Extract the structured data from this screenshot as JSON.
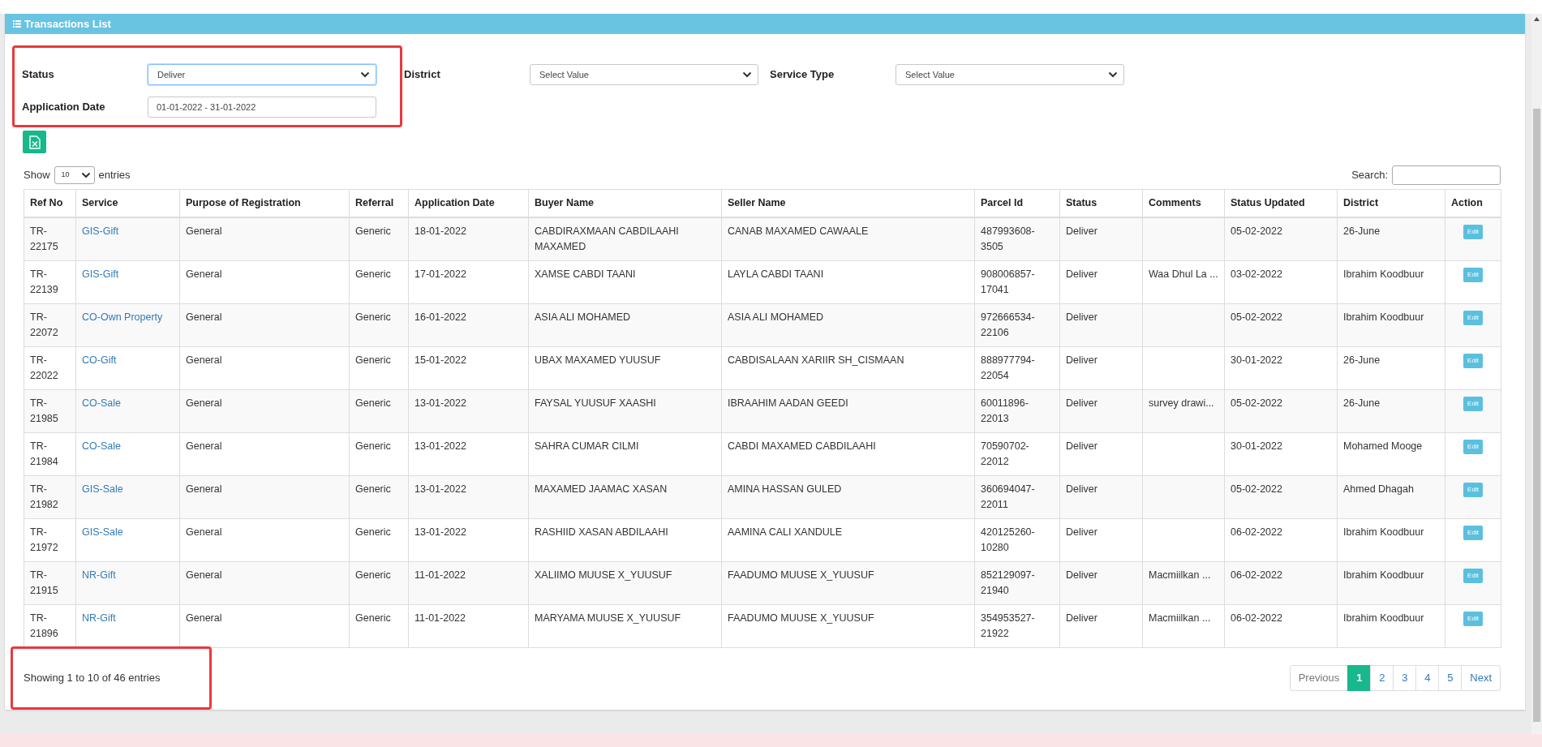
{
  "panel": {
    "title": "Transactions List"
  },
  "filter_groups": [
    {
      "highlighted": true,
      "fields": [
        {
          "label": "Status",
          "kind": "select",
          "value": "Deliver",
          "focused": true
        },
        {
          "label": "Application Date",
          "kind": "text",
          "value": "01-01-2022 - 31-01-2022",
          "focused": false
        }
      ]
    },
    {
      "highlighted": false,
      "fields": [
        {
          "label": "District",
          "kind": "select",
          "value": "Select Value",
          "focused": false
        }
      ]
    },
    {
      "highlighted": false,
      "fields": [
        {
          "label": "Service Type",
          "kind": "select",
          "value": "Select Value",
          "focused": false
        }
      ]
    }
  ],
  "length_control": {
    "before": "Show",
    "value": "10",
    "after": "entries"
  },
  "search": {
    "label": "Search:"
  },
  "table": {
    "columns": [
      {
        "label": "Ref No",
        "kind": "text"
      },
      {
        "label": "Service",
        "kind": "link"
      },
      {
        "label": "Purpose of Registration",
        "kind": "text"
      },
      {
        "label": "Referral",
        "kind": "text"
      },
      {
        "label": "Application Date",
        "kind": "text"
      },
      {
        "label": "Buyer Name",
        "kind": "text"
      },
      {
        "label": "Seller Name",
        "kind": "text"
      },
      {
        "label": "Parcel Id",
        "kind": "text"
      },
      {
        "label": "Status",
        "kind": "text"
      },
      {
        "label": "Comments",
        "kind": "text"
      },
      {
        "label": "Status Updated",
        "kind": "text"
      },
      {
        "label": "District",
        "kind": "text"
      },
      {
        "label": "Action",
        "kind": "button"
      }
    ],
    "rows": [
      [
        "TR-22175",
        "GIS-Gift",
        "General",
        "Generic",
        "18-01-2022",
        "CABDIRAXMAAN CABDILAAHI MAXAMED",
        "CANAB MAXAMED CAWAALE",
        "487993608-3505",
        "Deliver",
        "",
        "05-02-2022",
        "26-June",
        "Edit"
      ],
      [
        "TR-22139",
        "GIS-Gift",
        "General",
        "Generic",
        "17-01-2022",
        "XAMSE CABDI TAANI",
        "LAYLA CABDI TAANI",
        "908006857-17041",
        "Deliver",
        "Waa Dhul La ...",
        "03-02-2022",
        "Ibrahim Koodbuur",
        "Edit"
      ],
      [
        "TR-22072",
        "CO-Own Property",
        "General",
        "Generic",
        "16-01-2022",
        "ASIA ALI MOHAMED",
        "ASIA ALI MOHAMED",
        "972666534-22106",
        "Deliver",
        "",
        "05-02-2022",
        "Ibrahim Koodbuur",
        "Edit"
      ],
      [
        "TR-22022",
        "CO-Gift",
        "General",
        "Generic",
        "15-01-2022",
        "UBAX MAXAMED YUUSUF",
        "CABDISALAAN XARIIR SH_CISMAAN",
        "888977794-22054",
        "Deliver",
        "",
        "30-01-2022",
        "26-June",
        "Edit"
      ],
      [
        "TR-21985",
        "CO-Sale",
        "General",
        "Generic",
        "13-01-2022",
        "FAYSAL YUUSUF XAASHI",
        "IBRAAHIM AADAN GEEDI",
        "60011896-22013",
        "Deliver",
        "survey drawi...",
        "05-02-2022",
        "26-June",
        "Edit"
      ],
      [
        "TR-21984",
        "CO-Sale",
        "General",
        "Generic",
        "13-01-2022",
        "SAHRA CUMAR CILMI",
        "CABDI MAXAMED CABDILAAHI",
        "70590702-22012",
        "Deliver",
        "",
        "30-01-2022",
        "Mohamed Mooge",
        "Edit"
      ],
      [
        "TR-21982",
        "GIS-Sale",
        "General",
        "Generic",
        "13-01-2022",
        "MAXAMED JAAMAC XASAN",
        "AMINA HASSAN GULED",
        "360694047-22011",
        "Deliver",
        "",
        "05-02-2022",
        "Ahmed Dhagah",
        "Edit"
      ],
      [
        "TR-21972",
        "GIS-Sale",
        "General",
        "Generic",
        "13-01-2022",
        "RASHIID XASAN ABDILAAHI",
        "AAMINA CALI XANDULE",
        "420125260-10280",
        "Deliver",
        "",
        "06-02-2022",
        "Ibrahim Koodbuur",
        "Edit"
      ],
      [
        "TR-21915",
        "NR-Gift",
        "General",
        "Generic",
        "11-01-2022",
        "XALIIMO MUUSE X_YUUSUF",
        "FAADUMO MUUSE X_YUUSUF",
        "852129097-21940",
        "Deliver",
        "Macmiilkan ...",
        "06-02-2022",
        "Ibrahim Koodbuur",
        "Edit"
      ],
      [
        "TR-21896",
        "NR-Gift",
        "General",
        "Generic",
        "11-01-2022",
        "MARYAMA MUUSE X_YUUSUF",
        "FAADUMO MUUSE X_YUUSUF",
        "354953527-21922",
        "Deliver",
        "Macmiilkan ...",
        "06-02-2022",
        "Ibrahim Koodbuur",
        "Edit"
      ]
    ]
  },
  "info": {
    "text": "Showing 1 to 10 of 46 entries",
    "highlighted": true
  },
  "pagination": [
    {
      "label": "Previous",
      "kind": "nav",
      "selected": false
    },
    {
      "label": "1",
      "kind": "page",
      "selected": true
    },
    {
      "label": "2",
      "kind": "page",
      "selected": false
    },
    {
      "label": "3",
      "kind": "page",
      "selected": false
    },
    {
      "label": "4",
      "kind": "page",
      "selected": false
    },
    {
      "label": "5",
      "kind": "page",
      "selected": false
    },
    {
      "label": "Next",
      "kind": "nav",
      "selected": false
    }
  ]
}
